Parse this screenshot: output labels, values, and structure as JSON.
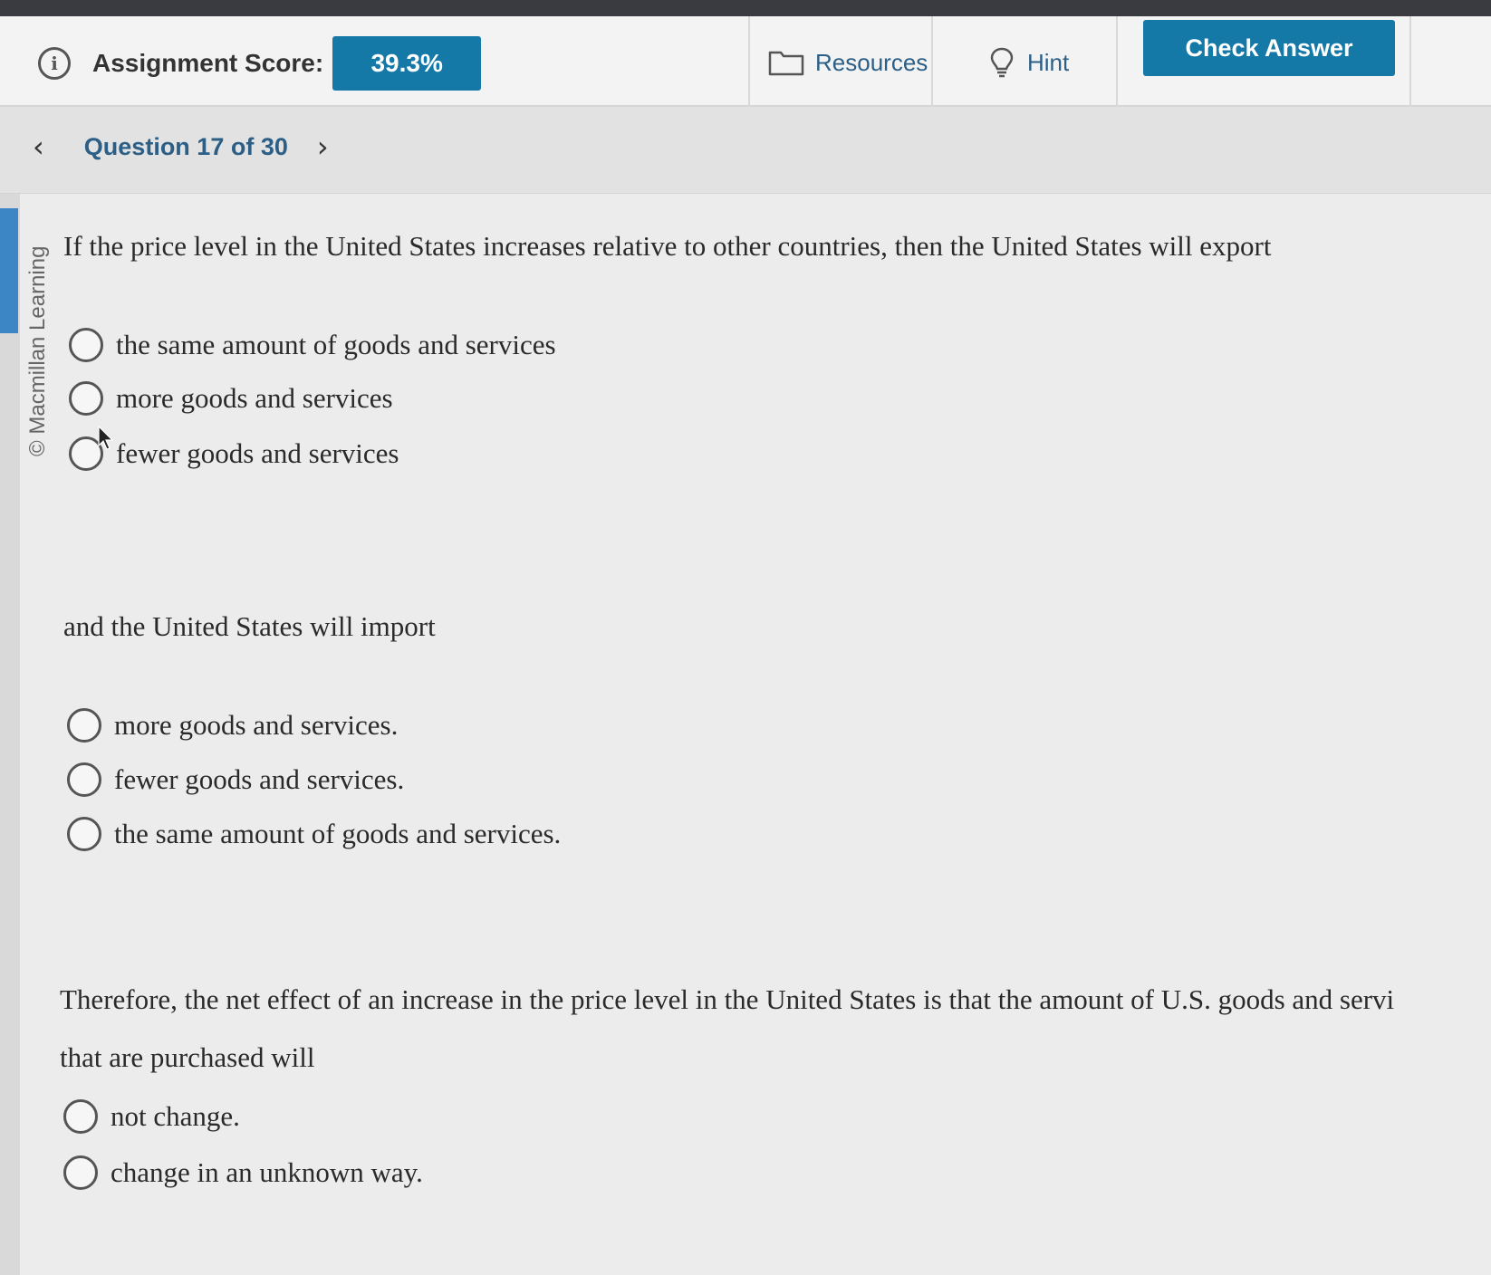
{
  "toolbar": {
    "score_label": "Assignment Score:",
    "score_value": "39.3%",
    "resources_label": "Resources",
    "hint_label": "Hint",
    "check_answer_label": "Check Answer",
    "icons": [
      "info-icon",
      "folder-icon",
      "lightbulb-icon"
    ]
  },
  "question_nav": {
    "label": "Question 17 of 30",
    "prev_icon": "chevron-left-icon",
    "next_icon": "chevron-right-icon"
  },
  "copyright": "© Macmillan Learning",
  "part1": {
    "prompt": "If the price level in the United States increases relative to other countries, then the United States will export",
    "options": [
      "the same amount of goods and services",
      "more goods and services",
      "fewer goods and services"
    ]
  },
  "part2": {
    "prompt": "and the United States will import",
    "options": [
      "more goods and services.",
      "fewer goods and services.",
      "the same amount of goods and services."
    ]
  },
  "part3": {
    "prompt_line1": "Therefore, the net effect of an increase in the price level in the United States is that the amount of U.S. goods and servi",
    "prompt_line2": "that are purchased will",
    "options": [
      "not change.",
      "change in an unknown way."
    ]
  },
  "colors": {
    "accent": "#1579a8",
    "link": "#2b5f87",
    "rail_accent": "#3d86c6"
  }
}
